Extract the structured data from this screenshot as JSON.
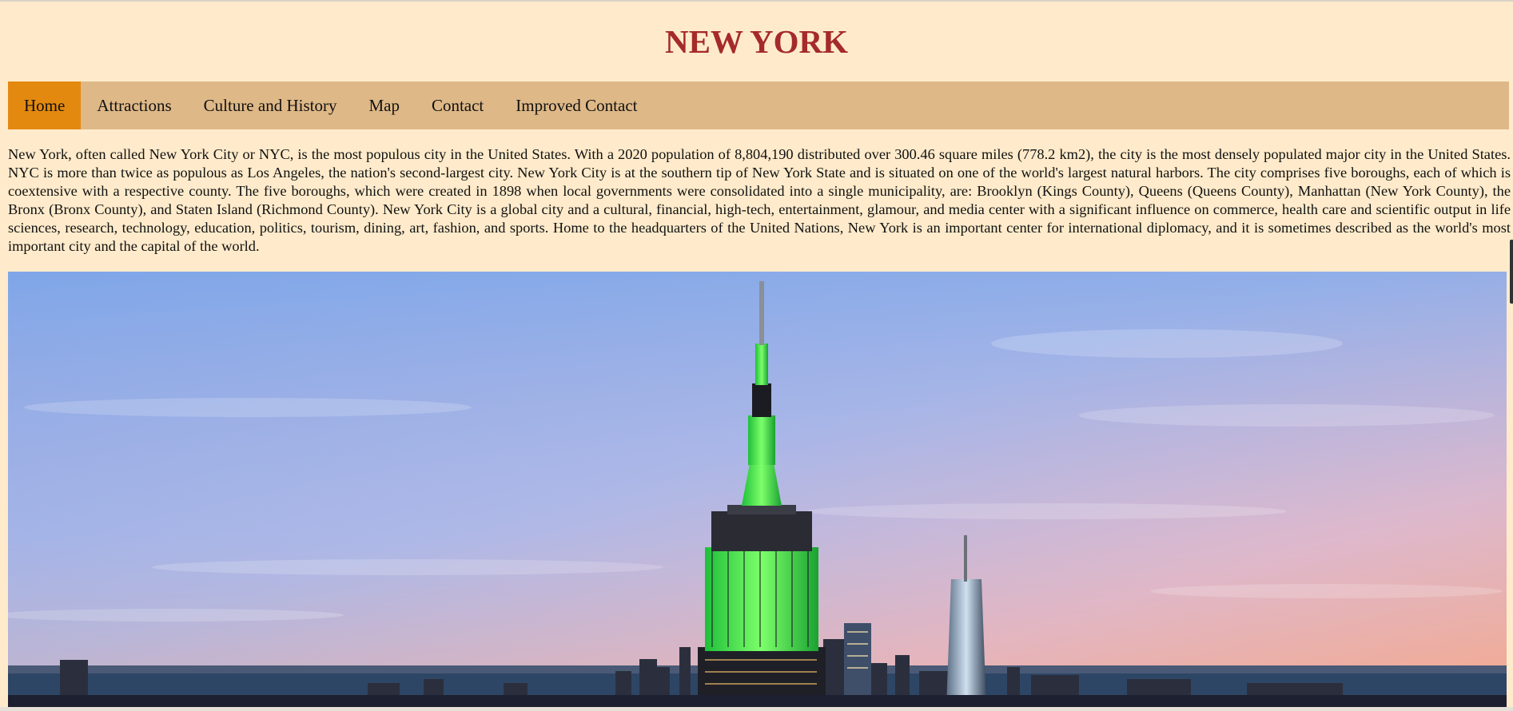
{
  "page": {
    "title": "NEW YORK"
  },
  "nav": {
    "items": [
      {
        "label": "Home"
      },
      {
        "label": "Attractions"
      },
      {
        "label": "Culture and History"
      },
      {
        "label": "Map"
      },
      {
        "label": "Contact"
      },
      {
        "label": "Improved Contact"
      }
    ],
    "active_index": 0
  },
  "intro": {
    "text": "New York, often called New York City or NYC, is the most populous city in the United States. With a 2020 population of 8,804,190 distributed over 300.46 square miles (778.2 km2), the city is the most densely populated major city in the United States. NYC is more than twice as populous as Los Angeles, the nation's second-largest city. New York City is at the southern tip of New York State and is situated on one of the world's largest natural harbors. The city comprises five boroughs, each of which is coextensive with a respective county. The five boroughs, which were created in 1898 when local governments were consolidated into a single municipality, are: Brooklyn (Kings County), Queens (Queens County), Manhattan (New York County), the Bronx (Bronx County), and Staten Island (Richmond County). New York City is a global city and a cultural, financial, high-tech, entertainment, glamour, and media center with a significant influence on commerce, health care and scientific output in life sciences, research, technology, education, politics, tourism, dining, art, fashion, and sports. Home to the headquarters of the United Nations, New York is an important center for international diplomacy, and it is sometimes described as the world's most important city and the capital of the world."
  },
  "colors": {
    "background": "#ffebcb",
    "title": "#a52a2a",
    "navbar": "#deb887",
    "nav_active": "#e4890f"
  }
}
